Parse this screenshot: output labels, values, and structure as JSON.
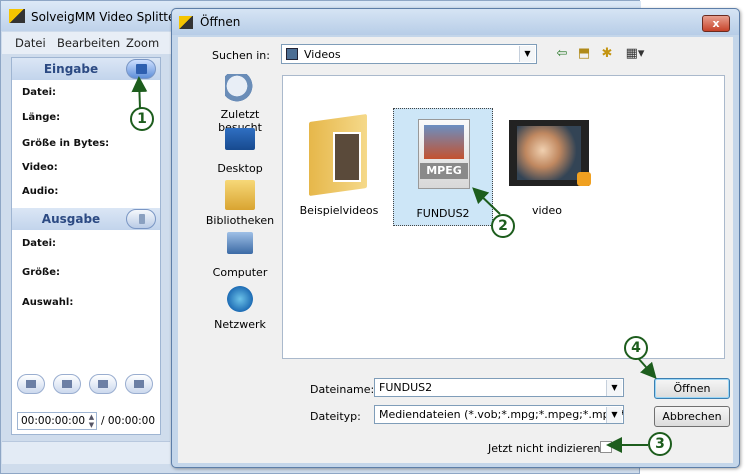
{
  "app": {
    "title": "SolveigMM Video Splitter",
    "menu": [
      "Datei",
      "Bearbeiten",
      "Zoom"
    ],
    "input_section": {
      "title": "Eingabe",
      "fields": [
        "Datei:",
        "Länge:",
        "Größe in Bytes:",
        "Video:",
        "Audio:"
      ]
    },
    "output_section": {
      "title": "Ausgabe",
      "fields": [
        "Datei:",
        "Größe:",
        "Auswahl:"
      ]
    },
    "time_start": "00:00:00:00",
    "time_end": "/ 00:00:00"
  },
  "dialog": {
    "title": "Öffnen",
    "close_label": "x",
    "look_in_label": "Suchen in:",
    "look_in_value": "Videos",
    "places": [
      {
        "label": "Zuletzt besucht",
        "icon": "recent-places-icon"
      },
      {
        "label": "Desktop",
        "icon": "desktop-icon"
      },
      {
        "label": "Bibliotheken",
        "icon": "libraries-icon"
      },
      {
        "label": "Computer",
        "icon": "computer-icon"
      },
      {
        "label": "Netzwerk",
        "icon": "network-icon"
      }
    ],
    "files": [
      {
        "name": "Beispielvideos",
        "icon": "folder-icon"
      },
      {
        "name": "FUNDUS2",
        "icon": "mpeg-file-icon",
        "badge": "MPEG"
      },
      {
        "name": "video",
        "icon": "video-thumbnail-icon"
      }
    ],
    "file_name_label": "Dateiname:",
    "file_name_value": "FUNDUS2",
    "file_type_label": "Dateityp:",
    "file_type_value": "Mediendateien (*.vob;*.mpg;*.mpeg;*.mpv;*.m2",
    "open_button": "Öffnen",
    "cancel_button": "Abbrechen",
    "no_index_label": "Jetzt nicht indizieren."
  },
  "callouts": [
    "1",
    "2",
    "3",
    "4"
  ],
  "colors": {
    "callout": "#1d5d1d",
    "selection": "#cde6f7",
    "section_title": "#2c4a83"
  }
}
